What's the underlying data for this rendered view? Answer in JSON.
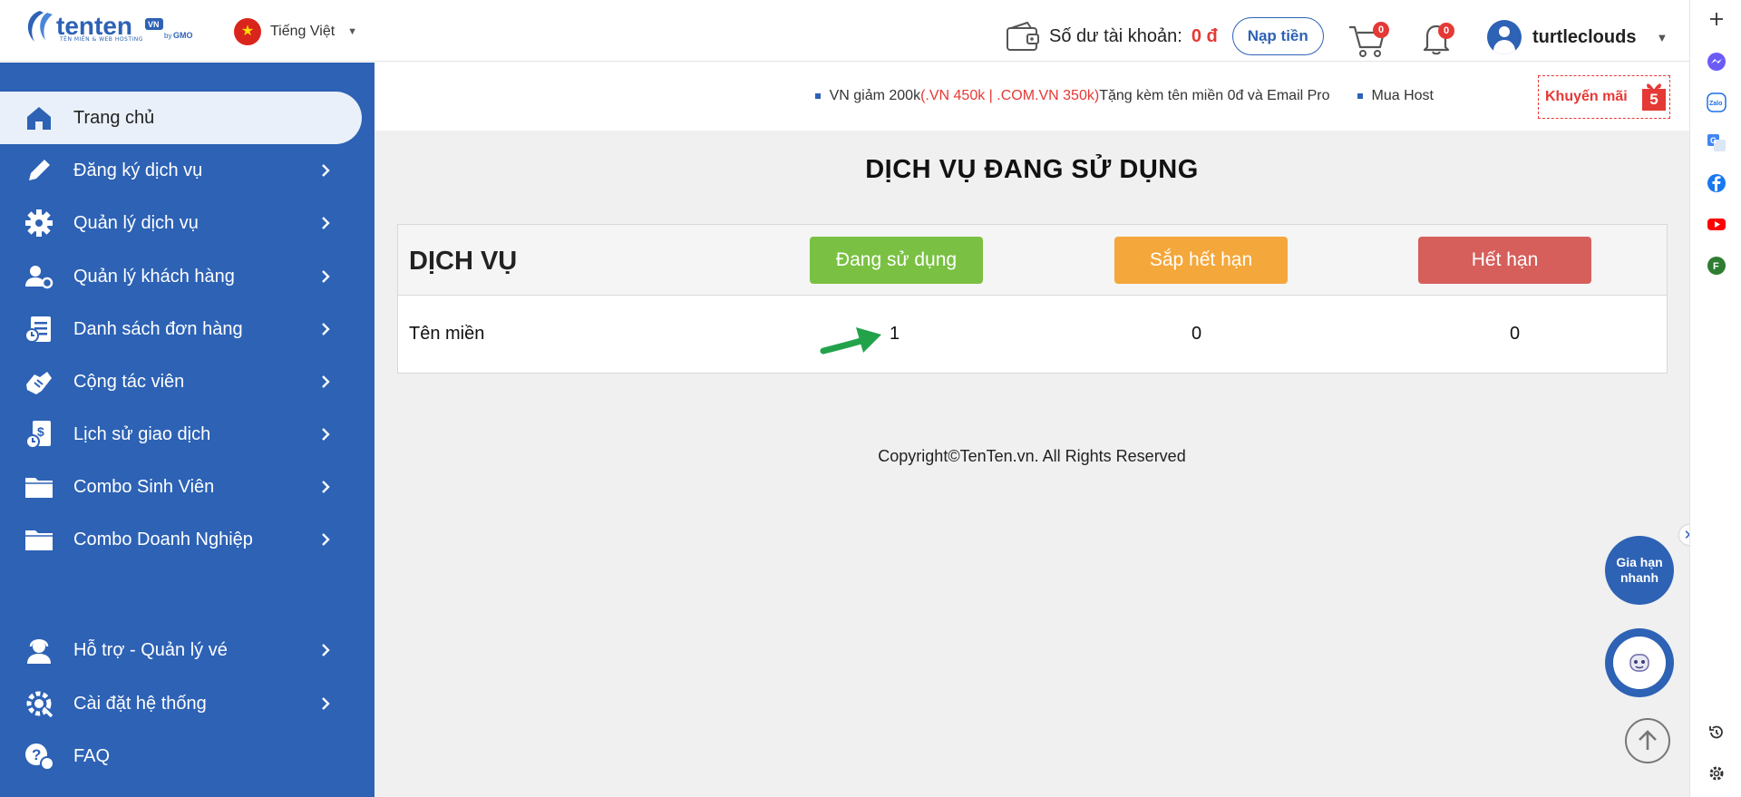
{
  "header": {
    "logo_text": "tenten",
    "logo_badge": "VN",
    "logo_gmo": "by GMO",
    "logo_tagline": "TÊN MIỀN & WEB HOSTING",
    "language": "Tiếng Việt",
    "balance_label": "Số dư tài khoản:",
    "balance_value": "0 đ",
    "topup_label": "Nạp tiền",
    "cart_count": "0",
    "notification_count": "0",
    "username": "turtleclouds"
  },
  "sidebar": {
    "items": [
      {
        "label": "Trang chủ",
        "icon": "home-icon"
      },
      {
        "label": "Đăng ký dịch vụ",
        "icon": "pencil-icon"
      },
      {
        "label": "Quản lý dịch vụ",
        "icon": "gear-icon"
      },
      {
        "label": "Quản lý khách hàng",
        "icon": "user-gear-icon"
      },
      {
        "label": "Danh sách đơn hàng",
        "icon": "order-list-icon"
      },
      {
        "label": "Cộng tác viên",
        "icon": "handshake-icon"
      },
      {
        "label": "Lịch sử giao dịch",
        "icon": "transaction-history-icon"
      },
      {
        "label": "Combo Sinh Viên",
        "icon": "folder-icon"
      },
      {
        "label": "Combo Doanh Nghiệp",
        "icon": "folder-icon"
      },
      {
        "label": "Hỗ trợ - Quản lý vé",
        "icon": "support-agent-icon"
      },
      {
        "label": "Cài đặt hệ thống",
        "icon": "settings-icon"
      },
      {
        "label": "FAQ",
        "icon": "faq-icon"
      }
    ]
  },
  "promo": {
    "text_prefix": "VN giảm 200k ",
    "text_highlight": "(.VN 450k | .COM.VN 350k)",
    "text_suffix": " Tặng kèm tên miền 0đ và Email Pro",
    "text_second": "Mua Host",
    "button_label": "Khuyến mãi",
    "button_count": "5"
  },
  "main": {
    "page_title": "DỊCH VỤ ĐANG SỬ DỤNG",
    "table": {
      "header_label": "DỊCH VỤ",
      "status_in_use": "Đang sử dụng",
      "status_expiring": "Sắp hết hạn",
      "status_expired": "Hết hạn",
      "rows": [
        {
          "name": "Tên miền",
          "in_use": "1",
          "expiring": "0",
          "expired": "0"
        }
      ]
    },
    "copyright": "Copyright©TenTen.vn. All Rights Reserved",
    "renew_button": "Gia hạn nhanh"
  },
  "colors": {
    "brand_blue": "#2d62b5",
    "in_use_green": "#7ac143",
    "expiring_orange": "#f4a73a",
    "expired_red": "#d65f5b",
    "alert_red": "#e53935"
  }
}
